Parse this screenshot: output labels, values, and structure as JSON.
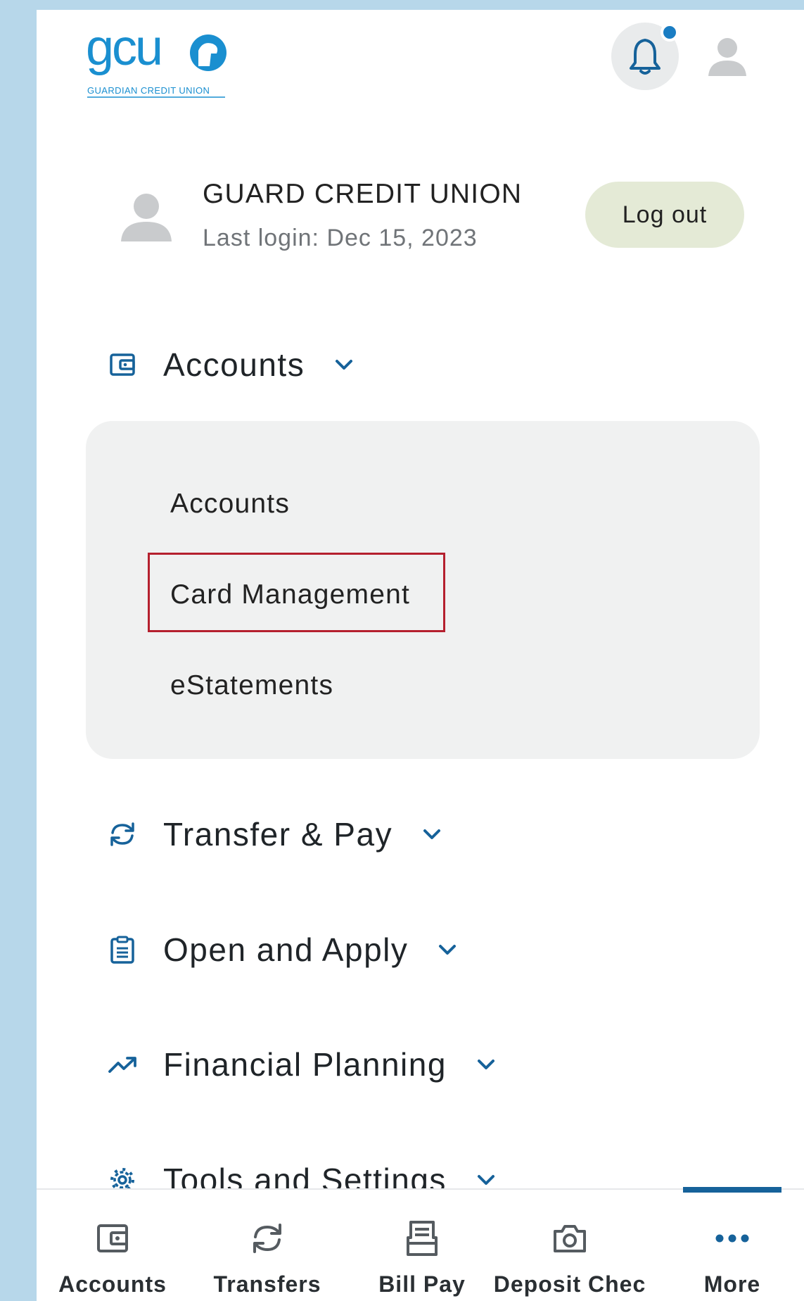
{
  "header": {
    "logo_text": "gcu",
    "logo_subtext": "GUARDIAN CREDIT UNION"
  },
  "user": {
    "name": "GUARD CREDIT UNION",
    "last_login": "Last login: Dec 15, 2023",
    "logout_label": "Log out"
  },
  "nav": {
    "accounts": {
      "label": "Accounts",
      "expanded": true,
      "items": [
        "Accounts",
        "Card Management",
        "eStatements"
      ]
    },
    "transfer_pay": {
      "label": "Transfer & Pay"
    },
    "open_apply": {
      "label": "Open and Apply"
    },
    "financial_planning": {
      "label": "Financial Planning"
    },
    "tools_settings": {
      "label": "Tools and Settings"
    }
  },
  "tabbar": {
    "tabs": [
      {
        "label": "Accounts",
        "icon": "wallet-icon"
      },
      {
        "label": "Transfers",
        "icon": "sync-icon"
      },
      {
        "label": "Bill Pay",
        "icon": "receipt-icon"
      },
      {
        "label": "Deposit Chec",
        "icon": "camera-icon"
      },
      {
        "label": "More",
        "icon": "more-icon",
        "selected": true
      }
    ]
  },
  "colors": {
    "brand_blue": "#1a7dc3",
    "icon_blue": "#16629a",
    "highlight_red": "#b5202e",
    "logout_bg": "#e4ead6"
  }
}
